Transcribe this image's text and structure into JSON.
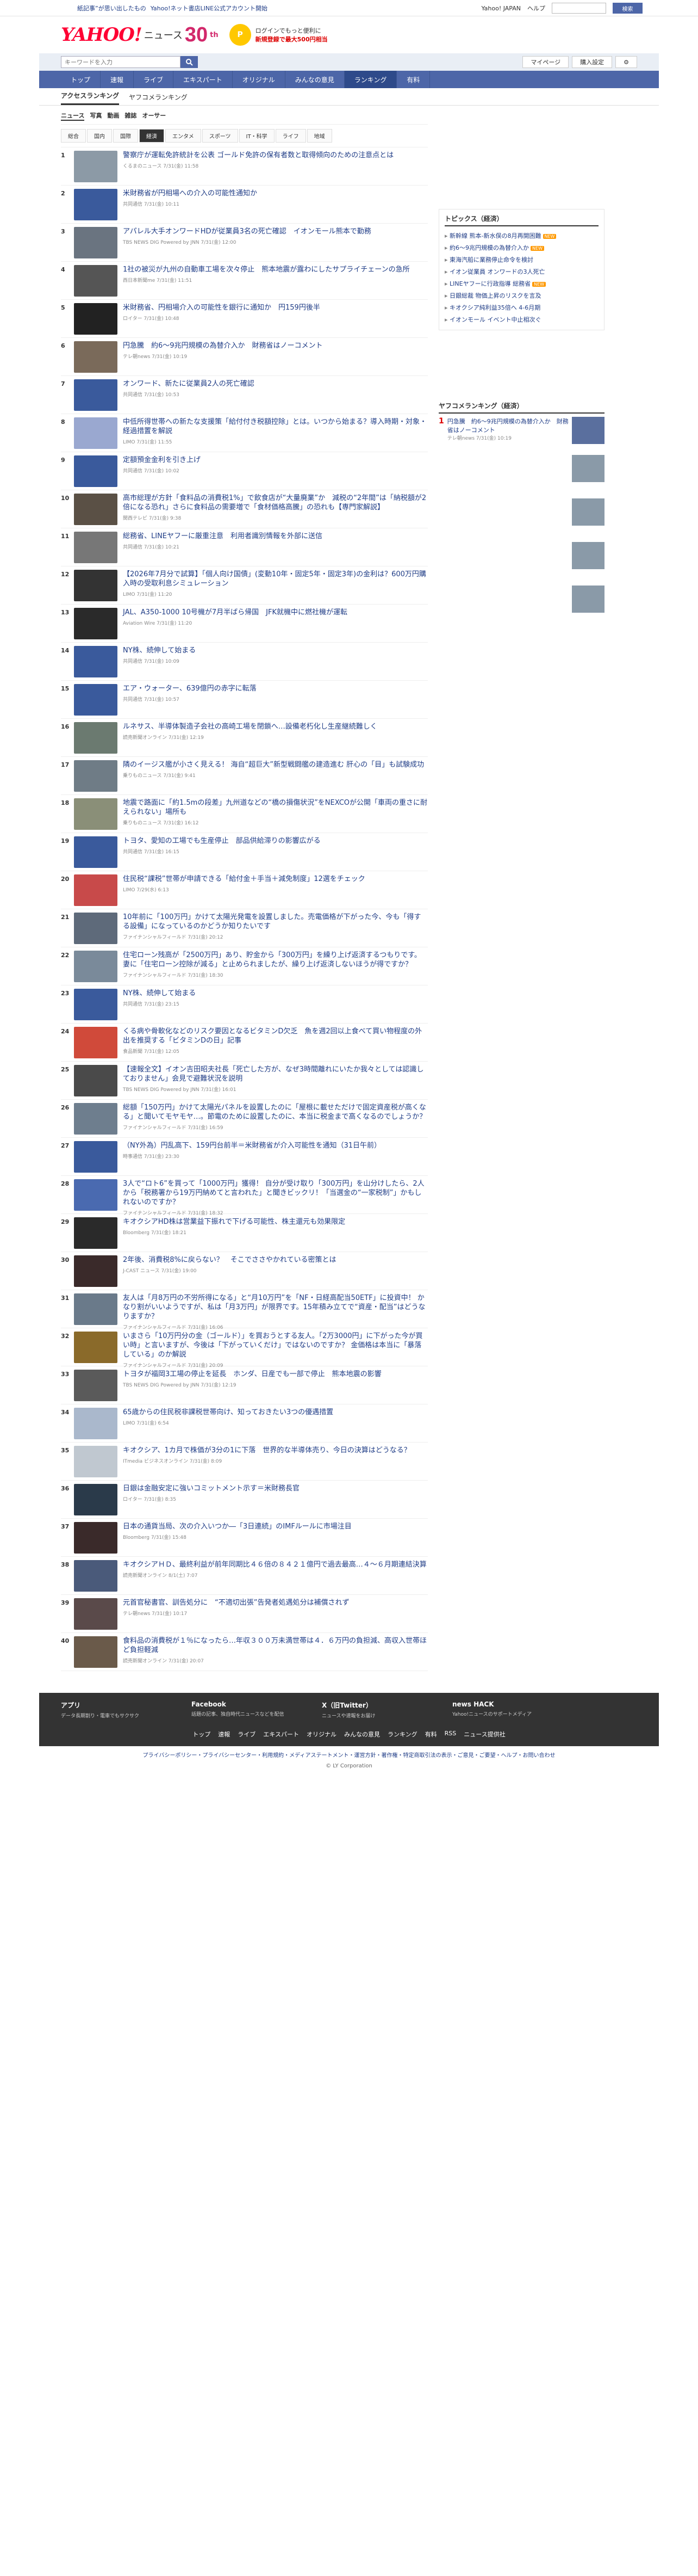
{
  "topline": {
    "left": [
      "紙記事”が思い出したもの",
      "Yahoo!ネット書店LINE公式アカウント開始"
    ],
    "right": [
      "Yahoo! JAPAN",
      "ヘルプ"
    ],
    "search_btn": "検索"
  },
  "header": {
    "logo_y": "YAHOO!",
    "logo_news": "ニュース",
    "logo_30": "30",
    "logo_th": "th",
    "promo_line1": "ログインでもっと便利に",
    "promo_line2": "新規登録で最大500円相当",
    "coin": "P"
  },
  "search": {
    "placeholder": "キーワードを入力",
    "btn_icon": "search-icon",
    "my_page": "マイページ",
    "subscribe": "購入設定"
  },
  "gnav": [
    "トップ",
    "速報",
    "ライブ",
    "エキスパート",
    "オリジナル",
    "みんなの意見",
    "ランキング",
    "有料"
  ],
  "gnav_active": 6,
  "subnav": [
    "アクセスランキング",
    "ヤフコメランキング"
  ],
  "cats": [
    "ニュース",
    "写真",
    "動画",
    "雑誌",
    "オーサー"
  ],
  "subcats": [
    "総合",
    "国内",
    "国際",
    "経済",
    "エンタメ",
    "スポーツ",
    "IT・科学",
    "ライフ",
    "地域"
  ],
  "subcats_active": 3,
  "articles": [
    {
      "num": "1",
      "title": "警察庁が運転免許統計を公表 ゴールド免許の保有者数と取得傾向のための注意点とは",
      "meta": "くるまのニュース 7/31(金) 11:58",
      "color": "#8c9aa6"
    },
    {
      "num": "2",
      "title": "米財務省が円相場への介入の可能性通知か",
      "meta": "共同通信 7/31(金) 10:11",
      "color": "#3a5a9c"
    },
    {
      "num": "3",
      "title": "アパレル大手オンワードHDが従業員3名の死亡確認　イオンモール熊本で勤務",
      "meta": "TBS NEWS DIG Powered by JNN 7/31(金) 12:00",
      "color": "#6a7480"
    },
    {
      "num": "4",
      "title": "1社の被災が九州の自動車工場を次々停止　熊本地震が露わにしたサプライチェーンの急所",
      "meta": "西日本新聞me 7/31(金) 11:51",
      "color": "#555"
    },
    {
      "num": "5",
      "title": "米財務省、円相場介入の可能性を銀行に通知か　円159円後半",
      "meta": "ロイター 7/31(金) 10:48",
      "color": "#222"
    },
    {
      "num": "6",
      "title": "円急騰　約6～9兆円規模の為替介入か　財務省はノーコメント",
      "meta": "テレ朝news 7/31(金) 10:19",
      "color": "#7a6a5a"
    },
    {
      "num": "7",
      "title": "オンワード、新たに従業員2人の死亡確認",
      "meta": "共同通信 7/31(金) 10:53",
      "color": "#3a5a9c"
    },
    {
      "num": "8",
      "title": "中低所得世帯への新たな支援策「給付付き税額控除」とは。いつから始まる？導入時期・対象・経過措置を解説",
      "meta": "LIMO 7/31(金) 11:55",
      "color": "#9aa8d0"
    },
    {
      "num": "9",
      "title": "定額預金金利を引き上げ",
      "meta": "共同通信 7/31(金) 10:02",
      "color": "#3a5a9c"
    },
    {
      "num": "10",
      "title": "高市総理が方針「食料品の消費税1%」で飲食店が“大量廃業”か　減税の“2年間”は「納税額が2倍になる恐れ」さらに食料品の需要増で「食材価格高騰」の恐れも【専門家解説】",
      "meta": "関西テレビ 7/31(金) 9:38",
      "color": "#5a5045"
    },
    {
      "num": "11",
      "title": "総務省、LINEヤフーに厳重注意　利用者識別情報を外部に送信",
      "meta": "共同通信 7/31(金) 10:21",
      "color": "#777"
    },
    {
      "num": "12",
      "title": "【2026年7月分で試算】「個人向け国債」(変動10年・固定5年・固定3年)の金利は？600万円購入時の受取利息シミュレーション",
      "meta": "LIMO 7/31(金) 11:20",
      "color": "#333"
    },
    {
      "num": "13",
      "title": "JAL、A350-1000 10号機が7月半ばら帰国　JFK就機中に燃社機が運転",
      "meta": "Aviation Wire 7/31(金) 11:20",
      "color": "#2a2a2a"
    },
    {
      "num": "14",
      "title": "NY株、続伸して始まる",
      "meta": "共同通信 7/31(金) 10:09",
      "color": "#3a5a9c"
    },
    {
      "num": "15",
      "title": "エア・ウォーター、639億円の赤字に転落",
      "meta": "共同通信 7/31(金) 10:57",
      "color": "#3a5a9c"
    },
    {
      "num": "16",
      "title": "ルネサス、半導体製造子会社の高崎工場を閉鎖へ…設備老朽化し生産継続難しく",
      "meta": "読売新聞オンライン 7/31(金) 12:19",
      "color": "#6b7a70"
    },
    {
      "num": "17",
      "title": "隣のイージス艦が小さく見える！ 海自“超巨大”新型戦闘艦の建造進む 肝心の「目」も試験成功",
      "meta": "乗りものニュース 7/31(金) 9:41",
      "color": "#6f7c86"
    },
    {
      "num": "18",
      "title": "地震で路面に「約1.5mの段差」九州道などの“橋の損傷状況”をNEXCOが公開「車両の重さに耐えられない」場所も",
      "meta": "乗りものニュース 7/31(金) 16:12",
      "color": "#8a8f78"
    },
    {
      "num": "19",
      "title": "トヨタ、愛知の工場でも生産停止　部品供給滞りの影響広がる",
      "meta": "共同通信 7/31(金) 16:15",
      "color": "#3a5a9c"
    },
    {
      "num": "20",
      "title": "住民税“課税”世帯が申請できる「給付金＋手当＋減免制度」12選をチェック",
      "meta": "LIMO 7/29(水) 6:13",
      "color": "#c84a4a"
    },
    {
      "num": "21",
      "title": "10年前に「100万円」かけて太陽光発電を設置しました。売電価格が下がった今、今も「得する設備」になっているのかどうか知りたいです",
      "meta": "ファイナンシャルフィールド 7/31(金) 20:12",
      "color": "#5e6a7a"
    },
    {
      "num": "22",
      "title": "住宅ローン残高が「2500万円」あり、貯金から「300万円」を繰り上げ返済するつもりです。妻に「住宅ローン控除が減る」と止められましたが、繰り上げ返済しないほうが得ですか？",
      "meta": "ファイナンシャルフィールド 7/31(金) 18:30",
      "color": "#7a8a9a"
    },
    {
      "num": "23",
      "title": "NY株、続伸して始まる",
      "meta": "共同通信 7/31(金) 23:15",
      "color": "#3a5a9c"
    },
    {
      "num": "24",
      "title": "くる病や骨軟化などのリスク要因となるビタミンD欠乏　魚を週2回以上食べて買い物程度の外出を推奨する「ビタミンDの日」記事",
      "meta": "食品新聞 7/31(金) 12:05",
      "color": "#d04a3a"
    },
    {
      "num": "25",
      "title": "【速報全文】イオン吉田昭夫社長「死亡した方が、なぜ3時間離れにいたか我々としては認識しておりません」会見で避難状況を説明",
      "meta": "TBS NEWS DIG Powered by JNN 7/31(金) 16:01",
      "color": "#4a4a4a"
    },
    {
      "num": "26",
      "title": "総額「150万円」かけて太陽光パネルを設置したのに「屋根に載せただけで固定資産税が高くなる」と聞いてモヤモヤ…。節電のために設置したのに、本当に税金まで高くなるのでしょうか？",
      "meta": "ファイナンシャルフィールド 7/31(金) 16:59",
      "color": "#6e7e8e"
    },
    {
      "num": "27",
      "title": "（NY外為）円乱高下、159円台前半＝米財務省が介入可能性を通知（31日午前）",
      "meta": "時事通信 7/31(金) 23:30",
      "color": "#3a5a9c"
    },
    {
      "num": "28",
      "title": "3人で“ロト6”を買って「1000万円」獲得！ 自分が受け取り「300万円」を山分けしたら、2人から「税務署から19万円納めてと言われた」と聞きビックリ！「当選金の“一家税制”」かもしれないのですか？",
      "meta": "ファイナンシャルフィールド 7/31(金) 18:32",
      "color": "#4a6ab0"
    },
    {
      "num": "29",
      "title": "キオクシアHD株は営業益下振れで下げる可能性、株主還元も効果限定",
      "meta": "Bloomberg 7/31(金) 18:21",
      "color": "#2a2a2a"
    },
    {
      "num": "30",
      "title": "2年後、消費税8%に戻らない？　そこでささやかれている密策とは",
      "meta": "J-CAST ニュース 7/31(金) 19:00",
      "color": "#3a2a2a"
    },
    {
      "num": "31",
      "title": "友人は「月8万円の不労所得になる」と“月10万円”を「NF・日経高配当50ETF」に投資中！ かなり割がいいようですが、私は「月3万円」が限界です。15年積み立てで“資産・配当”はどうなりますか？",
      "meta": "ファイナンシャルフィールド 7/31(金) 16:06",
      "color": "#6a7a8a"
    },
    {
      "num": "32",
      "title": "いまさら「10万円分の金（ゴールド）」を買おうとする友人。「2万3000円」に下がった今が買い時」と言いますが、今後は「下がっていくだけ」ではないのですか？ 金価格は本当に「暴落している」のか解説",
      "meta": "ファイナンシャルフィールド 7/31(金) 20:09",
      "color": "#8a6a2a"
    },
    {
      "num": "33",
      "title": "トヨタが福岡3工場の停止を延長　ホンダ、日産でも一部で停止　熊本地震の影響",
      "meta": "TBS NEWS DIG Powered by JNN 7/31(金) 12:19",
      "color": "#5a5a5a"
    },
    {
      "num": "34",
      "title": "65歳からの住民税非課税世帯向け、知っておきたい3つの優遇措置",
      "meta": "LIMO 7/31(金) 6:54",
      "color": "#aab8cc"
    },
    {
      "num": "35",
      "title": "キオクシア、1カ月で株価が3分の1に下落　世界的な半導体売り、今日の決算はどうなる？",
      "meta": "ITmedia ビジネスオンライン 7/31(金) 8:09",
      "color": "#c0c8d0"
    },
    {
      "num": "36",
      "title": "日銀は金融安定に強いコミットメント示す＝米財務長官",
      "meta": "ロイター 7/31(金) 8:35",
      "color": "#2a3a4a"
    },
    {
      "num": "37",
      "title": "日本の通貨当局、次の介入いつか―「3日連続」のIMFルールに市場注目",
      "meta": "Bloomberg 7/31(金) 15:48",
      "color": "#3a2a2a"
    },
    {
      "num": "38",
      "title": "キオクシアＨＤ、最終利益が前年同期比４６倍の８４２１億円で過去最高…４～６月期連結決算",
      "meta": "読売新聞オンライン 8/1(土) 7:07",
      "color": "#4a5a7a"
    },
    {
      "num": "39",
      "title": "元首官秘書官、訓告処分に　“不適切出張”告発者処遇処分は補償されず",
      "meta": "テレ朝news 7/31(金) 10:17",
      "color": "#5a4a4a"
    },
    {
      "num": "40",
      "title": "食料品の消費税が１％になったら…年収３００万未満世帯は４．６万円の負担減、高収入世帯ほど負担軽減",
      "meta": "読売新聞オンライン 7/31(金) 20:07",
      "color": "#6a5a4a"
    }
  ],
  "topics": {
    "heading": "トピックス（経済）",
    "items": [
      {
        "text": "新幹線 熊本-新水俣の8月再開困難",
        "badge": "NEW"
      },
      {
        "text": "約6～9兆円規模の為替介入か",
        "badge": "NEW"
      },
      {
        "text": "東海汽船に業務停止命令を検討",
        "badge": ""
      },
      {
        "text": "イオン従業員 オンワードの3人死亡",
        "badge": ""
      },
      {
        "text": "LINEヤフーに行政指導 総務省",
        "badge": "NEW"
      },
      {
        "text": "日銀総裁 物価上昇のリスクを言及",
        "badge": ""
      },
      {
        "text": "キオクシア純利益35倍へ 4-6月期",
        "badge": ""
      },
      {
        "text": "イオンモール イベント中止相次ぐ",
        "badge": ""
      }
    ]
  },
  "yahcomment": {
    "heading": "ヤフコメランキング（経済）",
    "item": {
      "n": "1",
      "title": "円急騰　約6～9兆円規模の為替介入か　財務省はノーコメント",
      "meta": "テレ朝news 7/31(金) 10:19"
    }
  },
  "footer": {
    "apps": [
      {
        "title": "アプリ",
        "desc": "データ長期割り・電車でもサクサク"
      },
      {
        "title": "Facebook",
        "desc": "話題の記事、独自時代ニュースなどを配信"
      },
      {
        "title": "X（旧Twitter）",
        "desc": "ニュースや速報をお届け"
      },
      {
        "title": "news HACK",
        "desc": "Yahoo!ニュースのサポートメディア"
      }
    ],
    "nav": [
      "トップ",
      "速報",
      "ライブ",
      "エキスパート",
      "オリジナル",
      "みんなの意見",
      "ランキング",
      "有料",
      "RSS",
      "ニュース提供社"
    ],
    "links": "プライバシーポリシー・プライバシーセンター・利用規約・メディアステートメント・運営方針・著作権・特定商取引法の表示・ご意見・ご要望・ヘルプ・お問い合わせ",
    "copy": "© LY Corporation"
  }
}
